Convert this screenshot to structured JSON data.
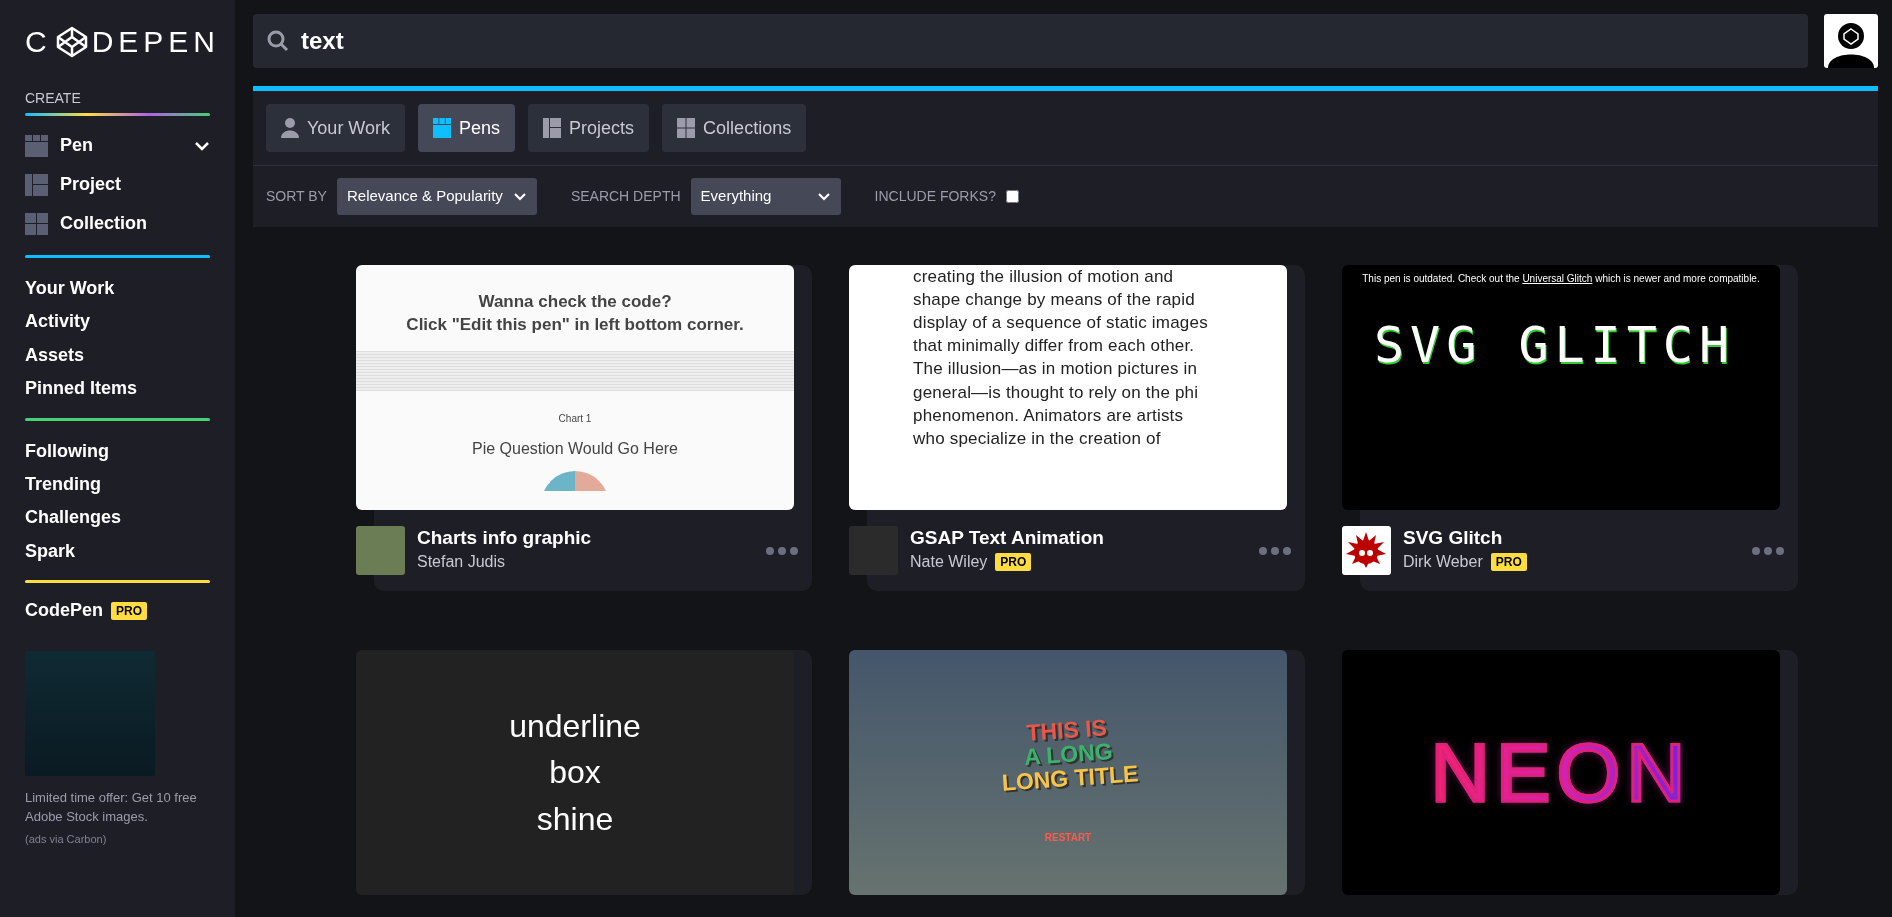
{
  "logo": {
    "before": "C",
    "after": "DEPEN"
  },
  "sidebar": {
    "create_label": "CREATE",
    "create_items": [
      {
        "label": "Pen",
        "kind": "pen",
        "has_menu": true
      },
      {
        "label": "Project",
        "kind": "project",
        "has_menu": false
      },
      {
        "label": "Collection",
        "kind": "collection",
        "has_menu": false
      }
    ],
    "nav_groups": [
      [
        "Your Work",
        "Activity",
        "Assets",
        "Pinned Items"
      ],
      [
        "Following",
        "Trending",
        "Challenges",
        "Spark"
      ]
    ],
    "account": {
      "label": "CodePen",
      "badge": "PRO"
    },
    "ad": {
      "text": "Limited time offer: Get 10 free Adobe Stock images.",
      "via": "(ads via Carbon)"
    }
  },
  "search": {
    "value": "text"
  },
  "tabs": [
    {
      "label": "Your Work",
      "kind": "user",
      "selected": false
    },
    {
      "label": "Pens",
      "kind": "pens",
      "selected": true
    },
    {
      "label": "Projects",
      "kind": "projects",
      "selected": false
    },
    {
      "label": "Collections",
      "kind": "collections",
      "selected": false
    }
  ],
  "filters": {
    "sort_label": "SORT BY",
    "sort_value": "Relevance & Popularity",
    "depth_label": "SEARCH DEPTH",
    "depth_value": "Everything",
    "forks_label": "INCLUDE FORKS?",
    "forks_checked": false
  },
  "cards": [
    {
      "kind": "chart",
      "preview": {
        "heading": [
          "Wanna check the code?",
          "Click \"Edit this pen\" in left bottom corner."
        ],
        "chart_title": "Chart 1",
        "question": "Pie Question Would Go Here"
      },
      "title": "Charts info graphic",
      "author": "Stefan Judis"
    },
    {
      "kind": "article",
      "preview": {
        "paragraph": "creating the illusion of motion and shape change by means of the rapid display of a sequence of static images that minimally differ from each other. The illusion—as in motion pictures in general—is thought to rely on the phi phenomenon. Animators are artists who specialize in the creation of"
      },
      "title": "GSAP Text Animation",
      "author": "Nate Wiley",
      "pro_badge": "PRO"
    },
    {
      "kind": "glitch",
      "preview": {
        "notice_before": "This pen is outdated. Check out the ",
        "notice_link": "Universal Glitch",
        "notice_after": " which is newer and more compatible.",
        "headline": "SVG GLITCH"
      },
      "title": "SVG Glitch",
      "author": "Dirk Weber",
      "pro_badge": "PRO"
    },
    {
      "kind": "words",
      "preview": {
        "words": [
          "underline",
          "box",
          "shine"
        ]
      }
    },
    {
      "kind": "gradient",
      "preview": {
        "lines": [
          "THIS IS",
          "A LONG",
          "LONG TITLE"
        ],
        "button": "RESTART"
      }
    },
    {
      "kind": "neon",
      "preview": {
        "headline": "NEON"
      }
    }
  ]
}
